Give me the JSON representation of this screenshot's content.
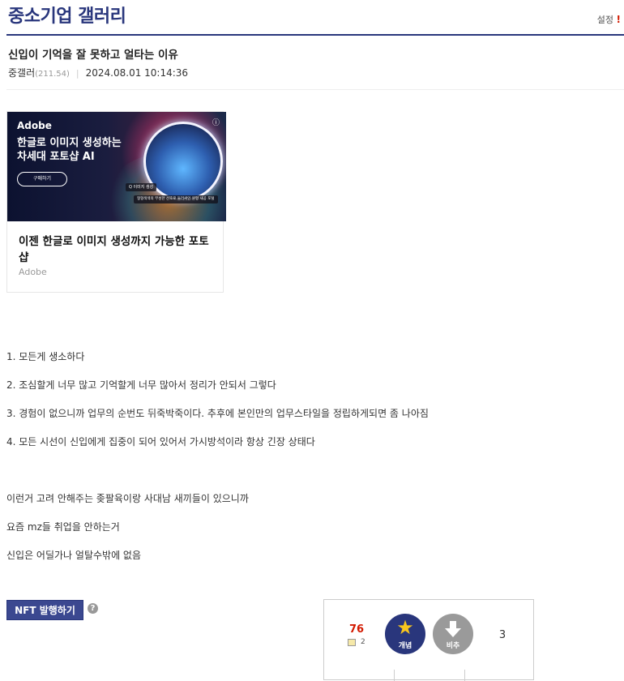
{
  "header": {
    "gallery_title": "중소기업 갤러리",
    "settings_label": "설정",
    "settings_marker": "!"
  },
  "post": {
    "title": "신입이 기억을 잘 못하고 얼타는 이유",
    "author": "중갤러",
    "ip": "(211.54)",
    "separator": "|",
    "datetime": "2024.08.01 10:14:36"
  },
  "ad": {
    "brand": "Adobe",
    "headline_line1": "한글로 이미지 생성하는",
    "headline_line2": "차세대 포토샵 AI",
    "cta_label": "구매하기",
    "chip1": "Q 이미지 생성",
    "chip2": "형형색색의 무성한 산호로 둘러싸인 원형 새공 포털",
    "caption": "이젠 한글로 이미지 생성까지 가능한 포토샵",
    "source": "Adobe",
    "info_icon": "ⓘ"
  },
  "body": {
    "lines": [
      "1. 모든게 생소하다",
      "2. 조심할게 너무 많고 기억할게 너무 많아서 정리가 안되서 그렇다",
      "3. 경험이 없으니까 업무의 순번도 뒤죽박죽이다. 추후에 본인만의 업무스타일을 정립하게되면 좀 나아짐",
      "4. 모든 시선이 신입에게 집중이 되어 있어서 가시방석이라 항상 긴장 상태다",
      "이런거 고려 안해주는 좆팔육이랑 사대남 새끼들이 있으니까",
      "요즘 mz들 취업을 안하는거",
      "신입은 어딜가나 얼탈수밖에 없음"
    ]
  },
  "actions": {
    "nft_button_label": "NFT 발행하기",
    "help_icon": "?"
  },
  "votes": {
    "up_count": "76",
    "fix_count": "2",
    "upvote_label": "개념",
    "downvote_label": "비추",
    "down_count": "3"
  },
  "colors": {
    "brand_navy": "#29367c",
    "accent_red": "#d31900",
    "downvote_gray": "#9a9a9a"
  }
}
